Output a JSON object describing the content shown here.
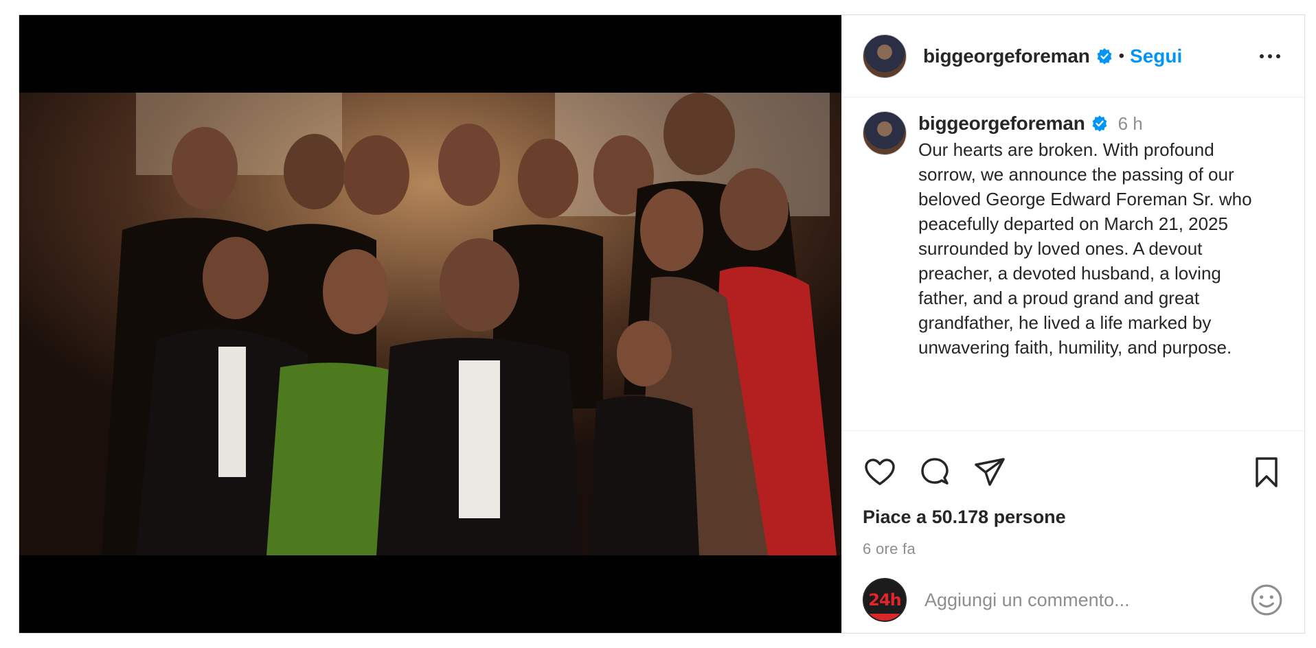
{
  "post": {
    "username": "biggeorgeforeman",
    "follow_label": "Segui",
    "separator": "•",
    "caption": {
      "username": "biggeorgeforeman",
      "time": "6 h",
      "text": "Our hearts are broken. With profound sorrow, we announce the passing of our beloved George Edward Foreman Sr. who peacefully departed on March 21, 2025 surrounded by loved ones. A devout preacher, a devoted husband, a loving father, and a proud grand and great grandfather, he lived a life marked by unwavering faith, humility, and purpose."
    },
    "likes_text": "Piace a 50.178 persone",
    "posted_ago": "6 ore fa",
    "comment": {
      "placeholder": "Aggiungi un commento..."
    },
    "my_avatar_badge": "24h",
    "colors": {
      "accent": "#0095f6",
      "verified": "#0095f6",
      "text": "#262626",
      "muted": "#8e8e8e"
    },
    "icons": {
      "like": "heart-icon",
      "comment": "comment-bubble-icon",
      "share": "paper-plane-icon",
      "save": "bookmark-icon",
      "more": "more-options-icon",
      "emoji": "smiley-icon"
    }
  }
}
